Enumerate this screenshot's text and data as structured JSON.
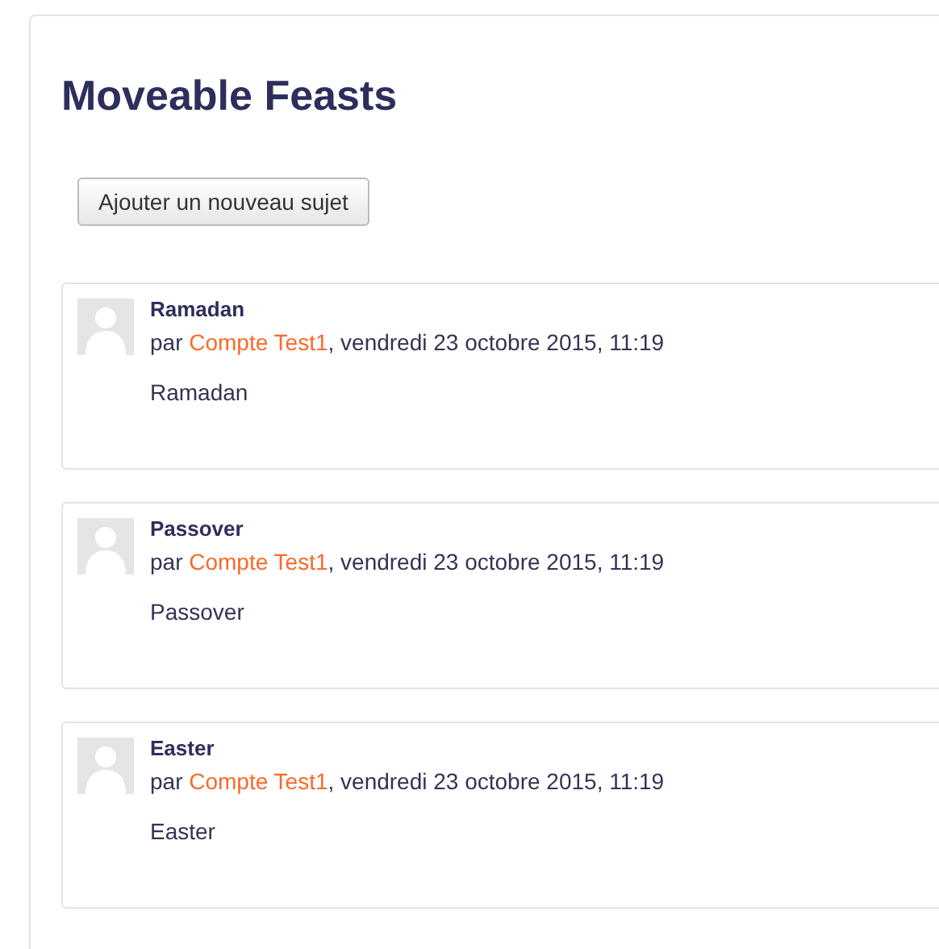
{
  "title": "Moveable Feasts",
  "add_button": "Ajouter un nouveau sujet",
  "posts": [
    {
      "subject": "Ramadan",
      "by": "par ",
      "author": "Compte Test1",
      "date": ", vendredi 23 octobre 2015, 11:19",
      "body": "Ramadan"
    },
    {
      "subject": "Passover",
      "by": "par ",
      "author": "Compte Test1",
      "date": ", vendredi 23 octobre 2015, 11:19",
      "body": "Passover"
    },
    {
      "subject": "Easter",
      "by": "par ",
      "author": "Compte Test1",
      "date": ", vendredi 23 octobre 2015, 11:19",
      "body": "Easter"
    }
  ]
}
